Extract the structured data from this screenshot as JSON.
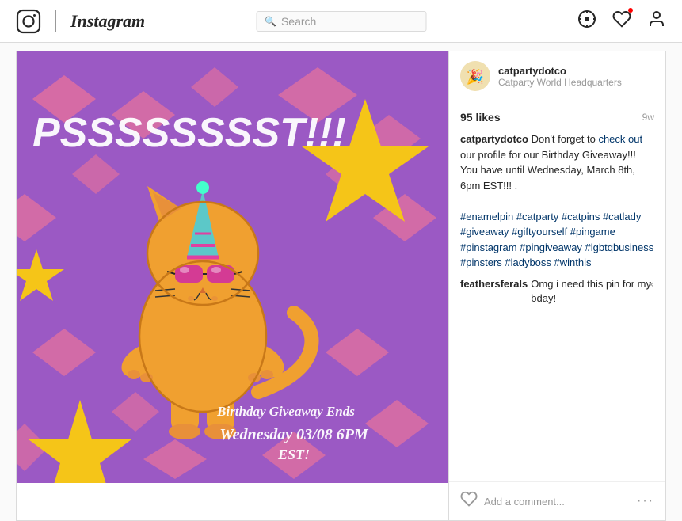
{
  "header": {
    "logo_alt": "Instagram",
    "search_placeholder": "Search",
    "icon_compass": "⊘",
    "icon_heart": "♡",
    "icon_person": "👤"
  },
  "post": {
    "username": "catpartydotco",
    "user_subtitle": "Catparty World Headquarters",
    "likes": "95 likes",
    "time_ago": "9w",
    "caption_author": "catpartydotco",
    "caption_text": " Don't forget to ",
    "caption_link": "check out",
    "caption_cont": " our profile for our Birthday Giveaway!!! You have until Wednesday, March 8th, 6pm EST!!! .",
    "hashtags": "#enamelpin #catparty #catpins #catlady #giveaway #giftyourself #pingame #pinstagram #pingiveaway #lgbtqbusiness #pinsters #ladyboss #winthis",
    "comment_author": "feathersferals",
    "comment_text": " Omg i need this pin for my bday!",
    "comment_placeholder": "Add a comment...",
    "psst_text": "PSSSSSSST!!!",
    "birthday_line1": "Birthday Giveaway Ends",
    "birthday_line2": "Wednesday 03/08 6PM",
    "birthday_line3": "EST!",
    "close_label": "×",
    "more_options": "···"
  }
}
